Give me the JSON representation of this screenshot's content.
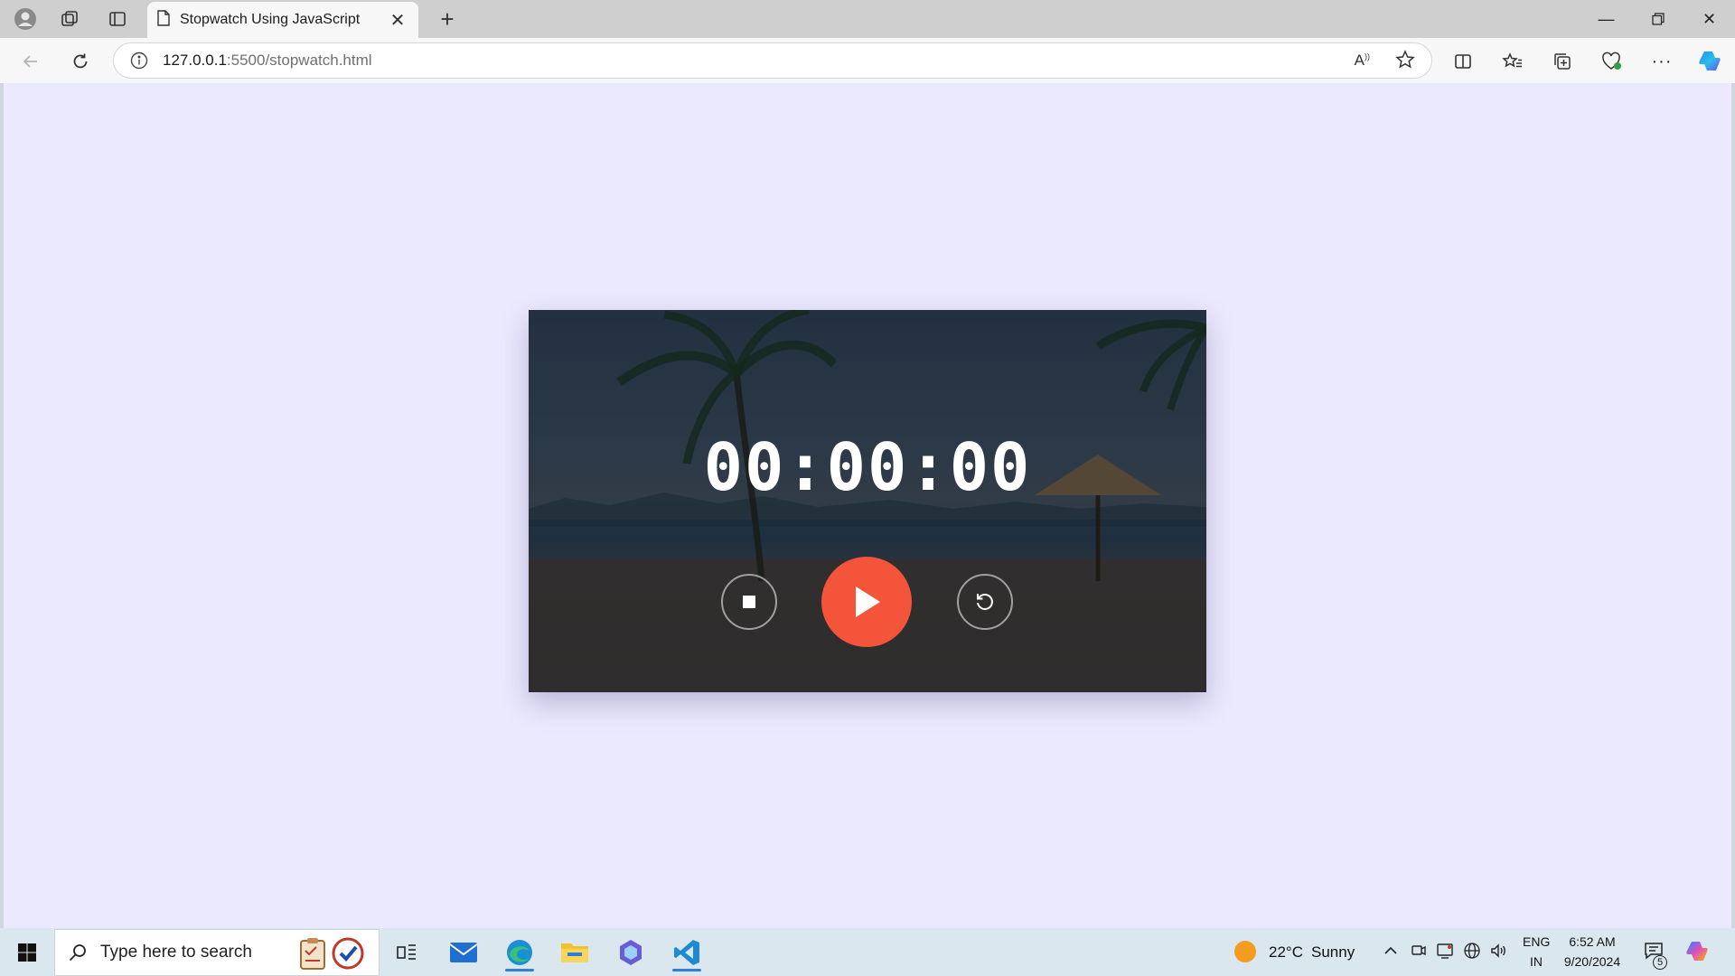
{
  "browser": {
    "tab_title": "Stopwatch Using JavaScript",
    "url_host": "127.0.0.1",
    "url_rest": ":5500/stopwatch.html"
  },
  "stopwatch": {
    "time": "00:00:00",
    "accent_color": "#f4553a",
    "background_color": "#ebe9fd"
  },
  "taskbar": {
    "search_placeholder": "Type here to search",
    "weather_temp": "22°C",
    "weather_text": "Sunny",
    "lang_top": "ENG",
    "lang_bottom": "IN",
    "time": "6:52 AM",
    "date": "9/20/2024",
    "notification_count": "5"
  }
}
